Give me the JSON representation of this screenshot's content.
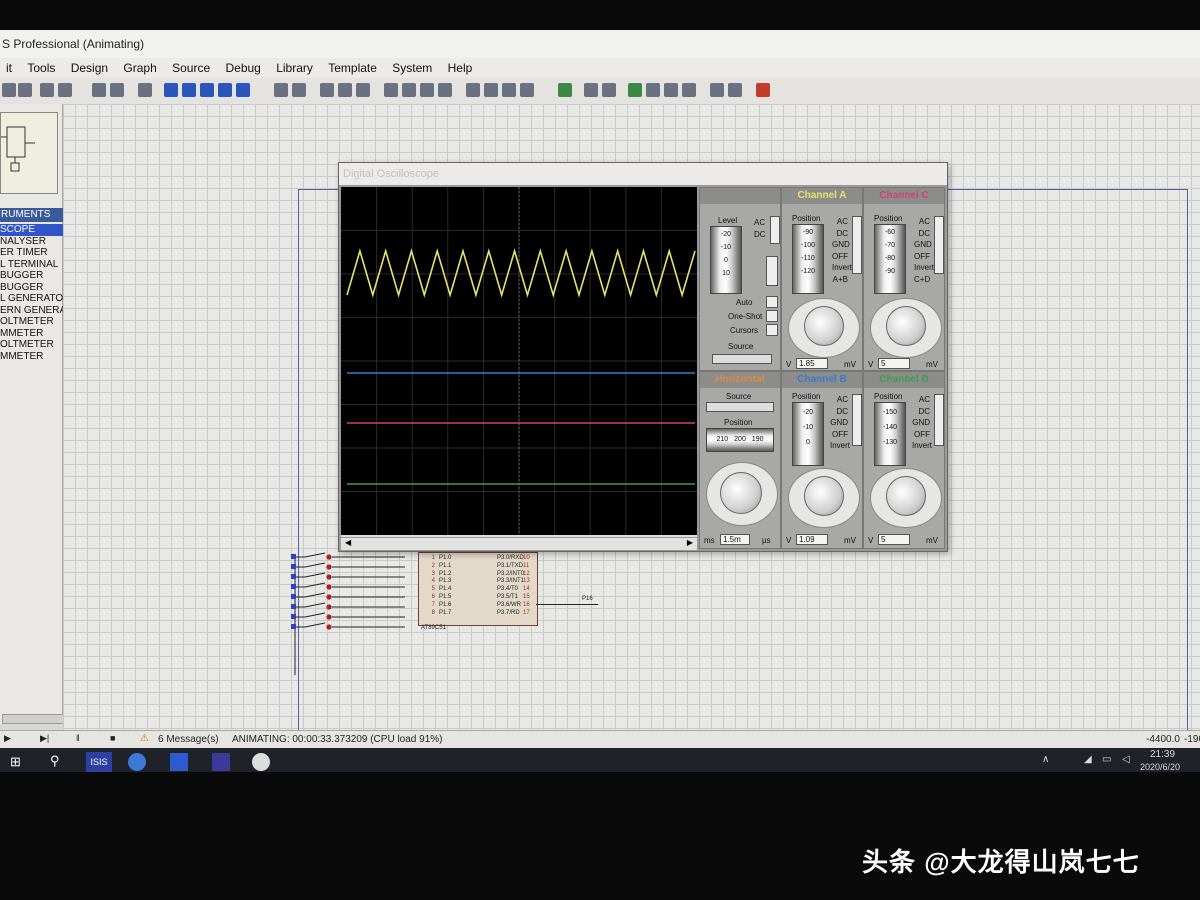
{
  "window": {
    "title": "S Professional (Animating)"
  },
  "menu": [
    "it",
    "Tools",
    "Design",
    "Graph",
    "Source",
    "Debug",
    "Library",
    "Template",
    "System",
    "Help"
  ],
  "instruments": {
    "header": "RUMENTS",
    "items": [
      "SCOPE",
      "NALYSER",
      "ER TIMER",
      "L TERMINAL",
      "BUGGER",
      "BUGGER",
      "L GENERATOR",
      "ERN GENERATOR",
      "OLTMETER",
      "MMETER",
      "OLTMETER",
      "MMETER"
    ],
    "selected_index": 0
  },
  "oscilloscope": {
    "title": "Digital Oscilloscope",
    "trigger": {
      "title": "",
      "level_label": "Level",
      "ticks": [
        "-20",
        "-10",
        "0",
        "10"
      ],
      "ac": "AC",
      "dc": "DC",
      "auto": "Auto",
      "one_shot": "One-Shot",
      "cursors": "Cursors",
      "source_label": "Source"
    },
    "channel_a": {
      "title": "Channel A",
      "position_label": "Position",
      "ticks": [
        "-90",
        "-100",
        "-110",
        "-120"
      ],
      "modes": [
        "AC",
        "DC",
        "GND",
        "OFF",
        "Invert",
        "A+B"
      ],
      "lcd_v": "1.85",
      "lcd_unit": "mV",
      "v_label": "V",
      "color": "#e8e070"
    },
    "channel_c": {
      "title": "Channel C",
      "position_label": "Position",
      "ticks": [
        "-60",
        "-70",
        "-80",
        "-90"
      ],
      "modes": [
        "AC",
        "DC",
        "GND",
        "OFF",
        "Invert",
        "C+D"
      ],
      "lcd_v": "5",
      "lcd_unit": "mV",
      "v_label": "V",
      "color": "#d0407a"
    },
    "horizontal": {
      "title": "Horizontal",
      "source_label": "Source",
      "position_label": "Position",
      "ticks": [
        "210",
        "200",
        "190"
      ],
      "lcd_v": "1.5m",
      "ms": "ms",
      "us": "µs"
    },
    "channel_b": {
      "title": "Channel B",
      "position_label": "Position",
      "ticks": [
        "-20",
        "-10",
        "0"
      ],
      "modes": [
        "AC",
        "DC",
        "GND",
        "OFF",
        "Invert"
      ],
      "lcd_v": "1.09",
      "lcd_unit": "mV",
      "v_label": "V",
      "color": "#3a7ad0"
    },
    "channel_d": {
      "title": "Channel D",
      "position_label": "Position",
      "ticks": [
        "-150",
        "-140",
        "-130"
      ],
      "modes": [
        "AC",
        "DC",
        "GND",
        "OFF",
        "Invert"
      ],
      "lcd_v": "5",
      "lcd_unit": "mV",
      "v_label": "V",
      "color": "#3aa050"
    }
  },
  "chip": {
    "name": "AT89C51",
    "left_pins": [
      "P1.0",
      "P1.1",
      "P1.2",
      "P1.3",
      "P1.4",
      "P1.5",
      "P1.6",
      "P1.7"
    ],
    "left_nums": [
      "1",
      "2",
      "3",
      "4",
      "5",
      "6",
      "7",
      "8"
    ],
    "right_pins": [
      "P3.0/RXD",
      "P3.1/TXD",
      "P3.2/INT0",
      "P3.3/INT1",
      "P3.4/T0",
      "P3.5/T1",
      "P3.6/WR",
      "P3.7/RD"
    ],
    "right_nums": [
      "10",
      "11",
      "12",
      "13",
      "14",
      "15",
      "16",
      "17"
    ],
    "net_label": "P16"
  },
  "status": {
    "messages": "6 Message(s)",
    "animating": "ANIMATING: 00:00:33.373209 (CPU load 91%)",
    "coord_left": "-4400.0",
    "coord_right": "-190"
  },
  "taskbar": {
    "time": "21:39",
    "date": "2020/6/20",
    "isis": "ISIS"
  },
  "watermark": "头条 @大龙得山岚七七"
}
